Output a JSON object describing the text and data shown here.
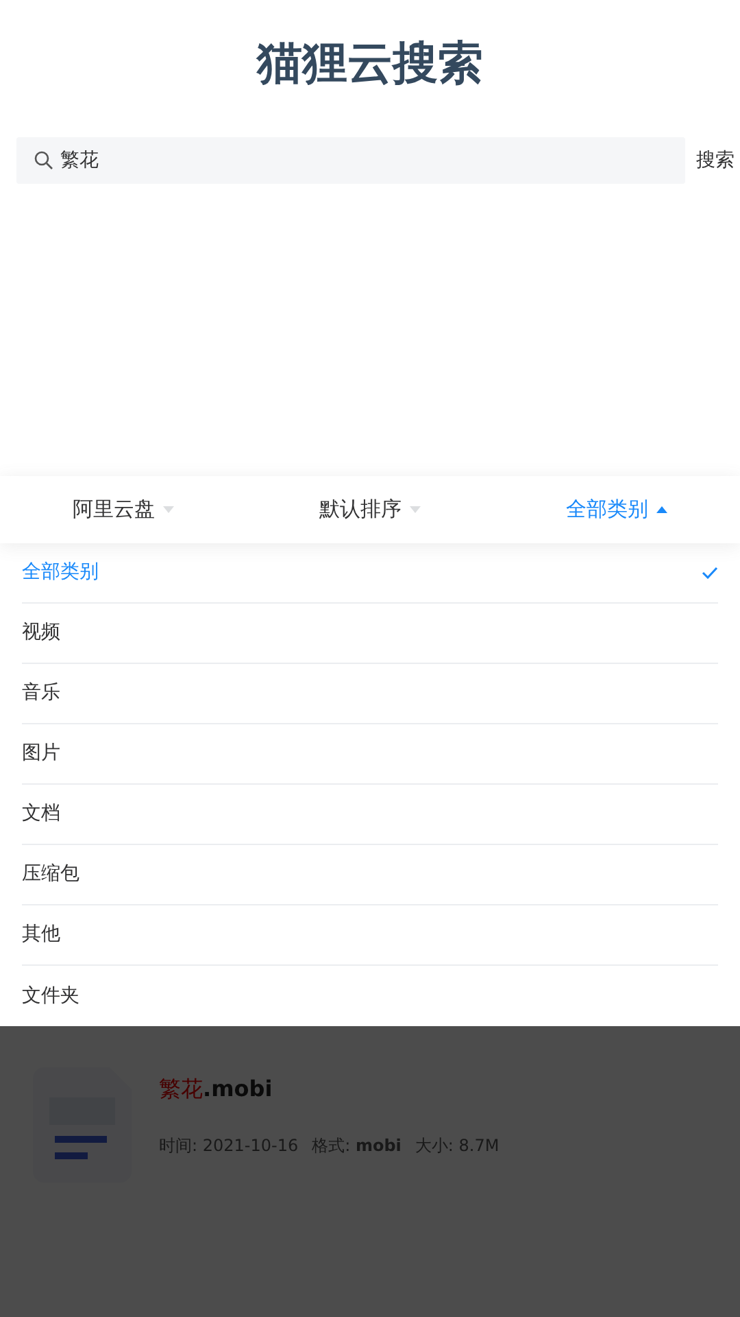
{
  "title": "猫狸云搜索",
  "search": {
    "value": "繁花",
    "button": "搜索"
  },
  "filters": [
    {
      "label": "阿里云盘",
      "selected": false
    },
    {
      "label": "默认排序",
      "selected": false
    },
    {
      "label": "全部类别",
      "selected": true
    }
  ],
  "options": [
    {
      "label": "全部类别",
      "selected": true
    },
    {
      "label": "视频",
      "selected": false
    },
    {
      "label": "音乐",
      "selected": false
    },
    {
      "label": "图片",
      "selected": false
    },
    {
      "label": "文档",
      "selected": false
    },
    {
      "label": "压缩包",
      "selected": false
    },
    {
      "label": "其他",
      "selected": false
    },
    {
      "label": "文件夹",
      "selected": false
    }
  ],
  "results": [
    {
      "title_parts": [
        {
          "text": "繁花",
          "highlight": true
        },
        {
          "text": ".mobi",
          "highlight": false
        }
      ],
      "meta": [
        "时间: 2021-10-16",
        "格式: **mobi**",
        "大小: 8.7M"
      ]
    }
  ]
}
